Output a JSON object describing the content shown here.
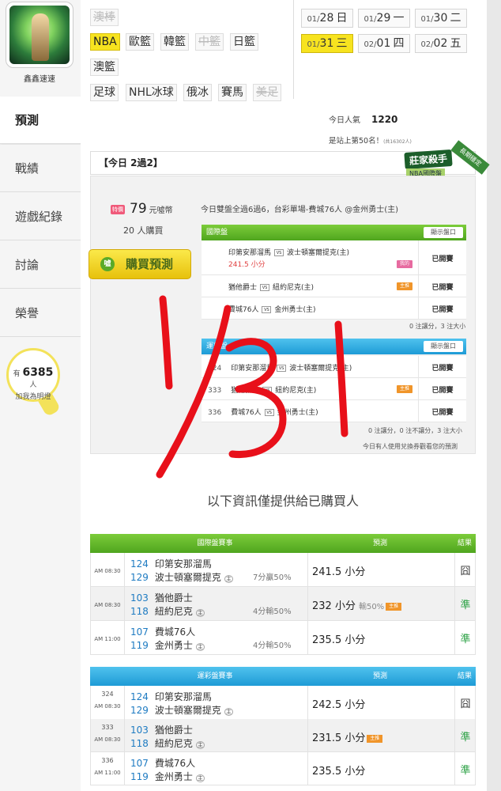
{
  "sidebar": {
    "username": "鑫鑫速速",
    "nav": [
      {
        "label": "預測",
        "active": true
      },
      {
        "label": "戰績",
        "active": false
      },
      {
        "label": "遊戲紀錄",
        "active": false
      },
      {
        "label": "討論",
        "active": false
      },
      {
        "label": "榮譽",
        "active": false
      }
    ],
    "fans_prefix": "有",
    "fans_count": "6385",
    "fans_unit": "人",
    "fans_label": "加我為明燈"
  },
  "categories": [
    {
      "label": "澳棒",
      "state": "disabled"
    },
    {
      "label": "NBA",
      "state": "active"
    },
    {
      "label": "歐籃",
      "state": "normal"
    },
    {
      "label": "韓籃",
      "state": "normal"
    },
    {
      "label": "中籃",
      "state": "disabled"
    },
    {
      "label": "日籃",
      "state": "normal"
    },
    {
      "label": "澳籃",
      "state": "normal"
    },
    {
      "label": "足球",
      "state": "normal"
    },
    {
      "label": "NHL冰球",
      "state": "normal"
    },
    {
      "label": "俄冰",
      "state": "normal"
    },
    {
      "label": "賽馬",
      "state": "normal"
    },
    {
      "label": "美足",
      "state": "disabled"
    }
  ],
  "dates": [
    {
      "md": "01/",
      "day": "28",
      "wd": "日",
      "active": false
    },
    {
      "md": "01/",
      "day": "29",
      "wd": "一",
      "active": false
    },
    {
      "md": "01/",
      "day": "30",
      "wd": "二",
      "active": false
    },
    {
      "md": "01/",
      "day": "31",
      "wd": "三",
      "active": true
    },
    {
      "md": "02/",
      "day": "01",
      "wd": "四",
      "active": false
    },
    {
      "md": "02/",
      "day": "02",
      "wd": "五",
      "active": false
    }
  ],
  "stats": {
    "popularity_label": "今日人氣",
    "popularity_value": "1220",
    "rank_text": "是站上第50名！",
    "rank_small": "(共16302人)"
  },
  "today": {
    "title": "【今日 2過2】",
    "badge_main": "莊家殺手",
    "badge_sub": "NBA國際盤",
    "badge_ribbon": "長期穩定",
    "price_tag": "特價",
    "price_value": "79",
    "price_unit": "元噓幣",
    "buyers": "20 人購買",
    "buy_icon": "噓",
    "buy_label": "購買預測",
    "summary": "今日雙盤全過6過6，台彩單場-費城76人 @金州勇士(主)",
    "intl_title": "國際盤",
    "show_odds": "顯示盤口",
    "intl_rows": [
      {
        "num": "",
        "away": "印第安那溜馬",
        "home": "波士頓塞爾提克(主)",
        "pick": "241.5 小分",
        "chip": "我的",
        "chip_color": "pink",
        "status": "已開賽"
      },
      {
        "num": "",
        "away": "猶他爵士",
        "home": "紐約尼克(主)",
        "pick": "",
        "chip": "主推",
        "chip_color": "orange",
        "status": "已開賽"
      },
      {
        "num": "",
        "away": "費城76人",
        "home": "金州勇士(主)",
        "pick": "",
        "chip": "",
        "chip_color": "",
        "status": "已開賽"
      }
    ],
    "intl_note": "0 注讓分，3 注大小",
    "lottery_title": "運彩盤",
    "lottery_rows": [
      {
        "num": "324",
        "away": "印第安那溜馬",
        "home": "波士頓塞爾提克(主)",
        "chip": "",
        "chip_color": "",
        "status": "已開賽"
      },
      {
        "num": "333",
        "away": "猶他爵士",
        "home": "紐約尼克(主)",
        "chip": "主推",
        "chip_color": "orange",
        "status": "已開賽"
      },
      {
        "num": "336",
        "away": "費城76人",
        "home": "金州勇士(主)",
        "chip": "",
        "chip_color": "",
        "status": "已開賽"
      }
    ],
    "lottery_note": "0 注讓分，0 注不讓分，3 注大小",
    "voucher_note": "今日有人使用兌換券觀看您的預測",
    "handwriting": "1/31"
  },
  "info_title": "以下資訊僅提供給已購買人",
  "intl_table": {
    "head_game": "國際盤賽事",
    "head_pred": "預測",
    "head_result": "結果",
    "rows": [
      {
        "lot": "",
        "time": "AM 08:30",
        "n1": "124",
        "t1": "印第安那溜馬",
        "n2": "129",
        "t2": "波士頓塞爾提克",
        "odds": "7分贏50%",
        "pred": "241.5 小分",
        "extra": "",
        "chip": "",
        "result": "囧",
        "win": false,
        "alt": false
      },
      {
        "lot": "",
        "time": "AM 08:30",
        "n1": "103",
        "t1": "猶他爵士",
        "n2": "118",
        "t2": "紐約尼克",
        "odds": "4分輸50%",
        "pred": "232 小分",
        "extra": "輸50%",
        "chip": "主推",
        "result": "準",
        "win": true,
        "alt": true
      },
      {
        "lot": "",
        "time": "AM 11:00",
        "n1": "107",
        "t1": "費城76人",
        "n2": "119",
        "t2": "金州勇士",
        "odds": "4分輸50%",
        "pred": "235.5 小分",
        "extra": "",
        "chip": "",
        "result": "準",
        "win": true,
        "alt": false
      }
    ]
  },
  "lottery_table": {
    "head_game": "運彩盤賽事",
    "head_pred": "預測",
    "head_result": "結果",
    "rows": [
      {
        "lot": "324",
        "time": "AM 08:30",
        "n1": "124",
        "t1": "印第安那溜馬",
        "n2": "129",
        "t2": "波士頓塞爾提克",
        "odds": "",
        "pred": "242.5 小分",
        "extra": "",
        "chip": "",
        "result": "囧",
        "win": false,
        "alt": false
      },
      {
        "lot": "333",
        "time": "AM 08:30",
        "n1": "103",
        "t1": "猶他爵士",
        "n2": "118",
        "t2": "紐約尼克",
        "odds": "",
        "pred": "231.5 小分",
        "extra": "",
        "chip": "主推",
        "result": "準",
        "win": true,
        "alt": true
      },
      {
        "lot": "336",
        "time": "AM 11:00",
        "n1": "107",
        "t1": "費城76人",
        "n2": "119",
        "t2": "金州勇士",
        "odds": "",
        "pred": "235.5 小分",
        "extra": "",
        "chip": "",
        "result": "準",
        "win": true,
        "alt": false
      }
    ]
  },
  "home_mark": "主",
  "vs_mark": "VS",
  "colors": {
    "accent_yellow": "#f7e31f",
    "intl_green": "#4fa51e",
    "lottery_blue": "#1e9bd6",
    "win_green": "#2aa043",
    "scribble_red": "#e8101a"
  }
}
